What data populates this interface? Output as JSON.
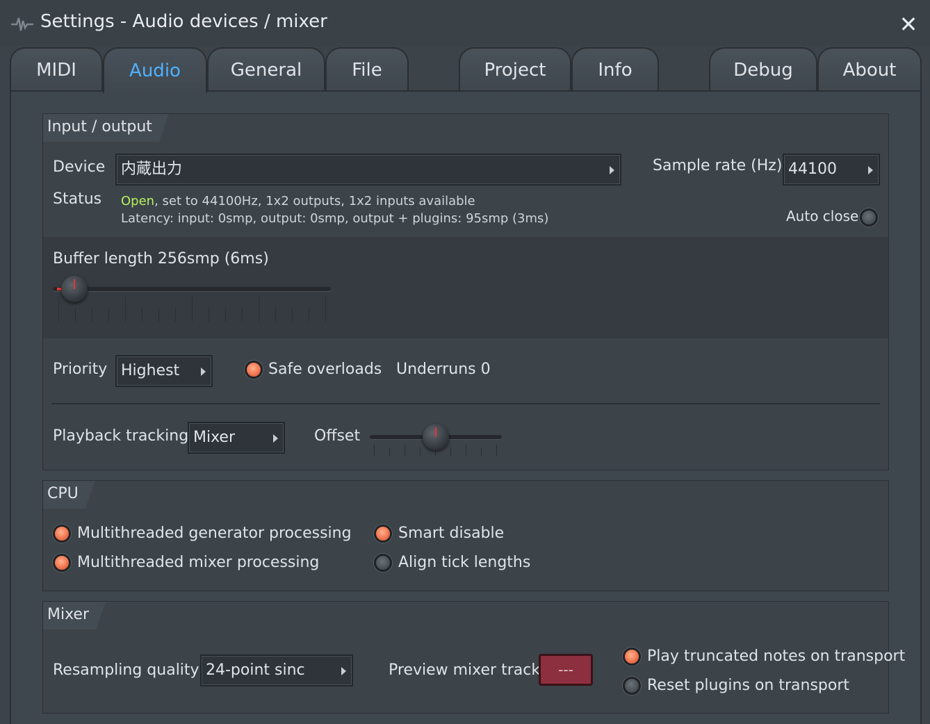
{
  "window": {
    "title": "Settings - Audio devices / mixer",
    "close_glyph": "✕"
  },
  "tabs": [
    {
      "label": "MIDI",
      "active": false
    },
    {
      "label": "Audio",
      "active": true
    },
    {
      "label": "General",
      "active": false
    },
    {
      "label": "File",
      "active": false
    },
    {
      "label": "Project",
      "active": false
    },
    {
      "label": "Info",
      "active": false
    },
    {
      "label": "Debug",
      "active": false
    },
    {
      "label": "About",
      "active": false
    }
  ],
  "io": {
    "title": "Input / output",
    "device_label": "Device",
    "device_value": "内蔵出力",
    "sample_rate_label": "Sample rate (Hz)",
    "sample_rate_value": "44100",
    "status_label": "Status",
    "status_open": "Open",
    "status_rest": ", set to 44100Hz, 1x2 outputs, 1x2 inputs available",
    "latency": "Latency: input: 0smp, output: 0smp, output + plugins: 95smp (3ms)",
    "auto_close_label": "Auto close",
    "auto_close_on": false,
    "buffer_label": "Buffer length 256smp (6ms)",
    "priority_label": "Priority",
    "priority_value": "Highest",
    "safe_overloads_label": "Safe overloads",
    "safe_overloads_on": true,
    "underruns_label": "Underruns 0",
    "playback_tracking_label": "Playback tracking",
    "playback_tracking_value": "Mixer",
    "offset_label": "Offset"
  },
  "cpu": {
    "title": "CPU",
    "mt_generator_label": "Multithreaded generator processing",
    "mt_generator_on": true,
    "mt_mixer_label": "Multithreaded mixer processing",
    "mt_mixer_on": true,
    "smart_disable_label": "Smart disable",
    "smart_disable_on": true,
    "align_tick_label": "Align tick lengths",
    "align_tick_on": false
  },
  "mixer": {
    "title": "Mixer",
    "resampling_label": "Resampling quality",
    "resampling_value": "24-point sinc",
    "preview_label": "Preview mixer track",
    "preview_value": "---",
    "play_truncated_label": "Play truncated notes on transport",
    "play_truncated_on": true,
    "reset_plugins_label": "Reset plugins on transport",
    "reset_plugins_on": false
  },
  "colors": {
    "accent_tab": "#4fb1ff",
    "status_open": "#b6f25d",
    "radio_on": "#f07650",
    "preview_button": "#8c2f3e"
  }
}
